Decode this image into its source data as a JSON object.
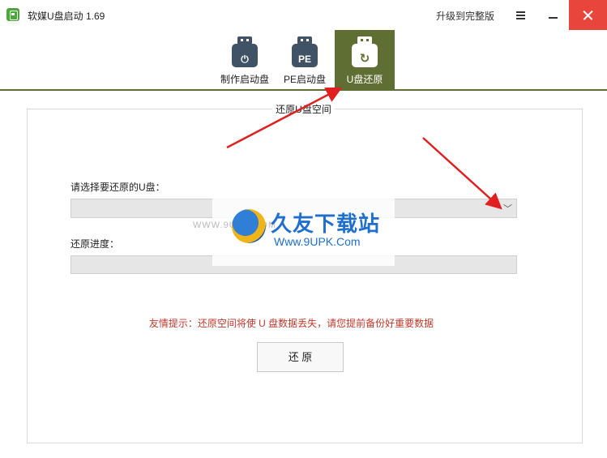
{
  "window": {
    "title": "软媒U盘启动 1.69",
    "upgrade_label": "升级到完整版"
  },
  "tabs": [
    {
      "label": "制作启动盘",
      "icon": "usb-power-icon",
      "glyph": "⏻",
      "active": false
    },
    {
      "label": "PE启动盘",
      "icon": "usb-pe-icon",
      "glyph": "PE",
      "active": false
    },
    {
      "label": "U盘还原",
      "icon": "usb-restore-icon",
      "glyph": "↻",
      "active": true
    }
  ],
  "restore": {
    "section_title": "还原U盘空间",
    "select_label": "请选择要还原的U盘：",
    "selected_value": "",
    "progress_label": "还原进度：",
    "progress_value": 0,
    "warning": "友情提示：还原空间将使 U 盘数据丢失，请您提前备份好重要数据",
    "button_label": "还 原"
  },
  "watermark": {
    "name": "久友下载站",
    "url": "Www.9UPK.Com",
    "faint_text": "WWW.9UPK.COM"
  },
  "colors": {
    "accent": "#5f6e33",
    "close": "#e8453c",
    "warning": "#c0392b",
    "arrow": "#e02020"
  }
}
